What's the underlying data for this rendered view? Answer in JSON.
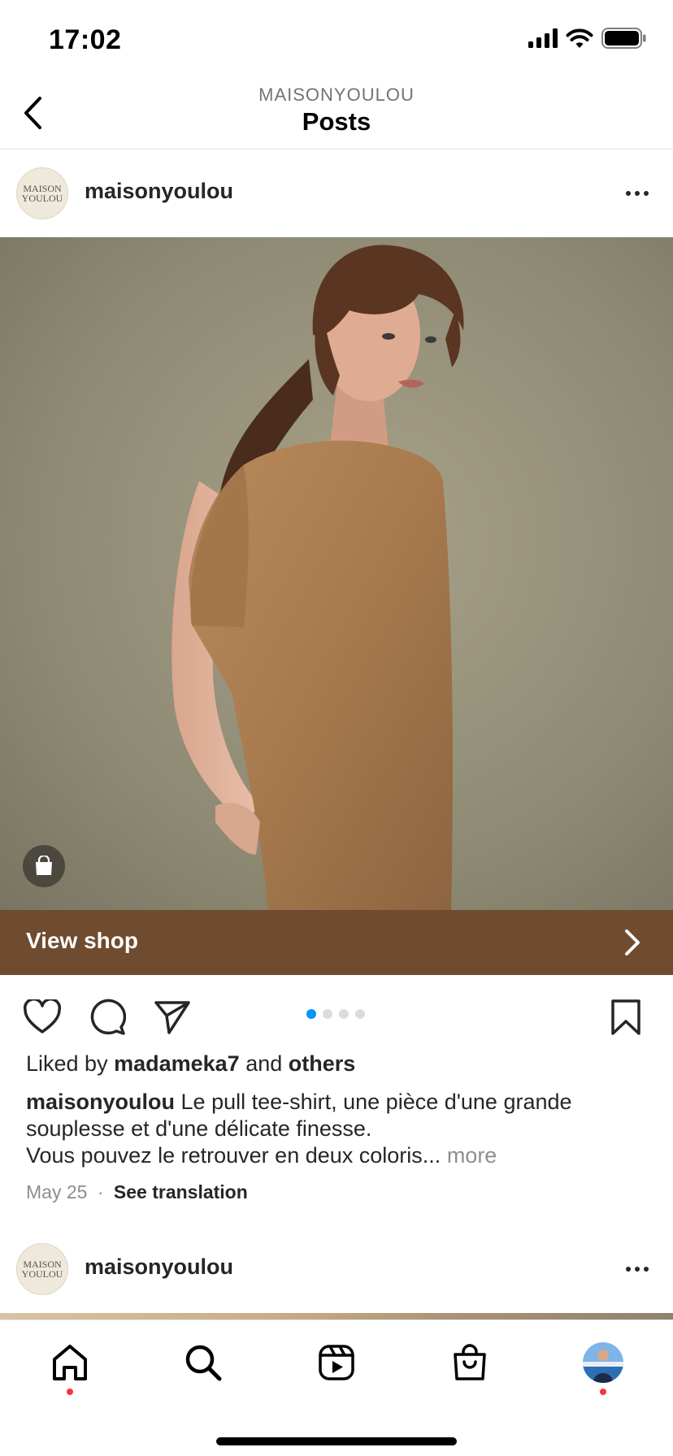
{
  "status_bar": {
    "time": "17:02"
  },
  "header": {
    "account": "MAISONYOULOU",
    "title": "Posts"
  },
  "posts": [
    {
      "avatar_text": [
        "MAISON",
        "YOULOU"
      ],
      "username": "maisonyoulou",
      "shop_cta": "View shop",
      "carousel": {
        "count": 4,
        "active_index": 0
      },
      "likes": {
        "prefix": "Liked by",
        "user": "madameka7",
        "conjunction": "and",
        "others": "others"
      },
      "caption": {
        "author": "maisonyoulou",
        "line1": "Le pull tee-shirt, une pièce d'une grande souplesse et d'une délicate finesse.",
        "line2": "Vous pouvez le retrouver en deux coloris...",
        "more": "more"
      },
      "date": "May 25",
      "separator": "·",
      "see_translation": "See translation"
    },
    {
      "avatar_text": [
        "MAISON",
        "YOULOU"
      ],
      "username": "maisonyoulou"
    }
  ],
  "icons": {
    "back": "chevron-left-icon",
    "more": "ellipsis-icon",
    "like": "heart-icon",
    "comment": "comment-icon",
    "share": "paper-plane-icon",
    "save": "bookmark-icon",
    "shop_tag": "shopping-bag-icon",
    "tabs": [
      "home-icon",
      "search-icon",
      "reels-icon",
      "shop-icon",
      "profile-avatar"
    ]
  },
  "colors": {
    "shop_banner": "#6f4b30",
    "active_dot": "#0095f6",
    "notification_dot": "#ff3040"
  }
}
